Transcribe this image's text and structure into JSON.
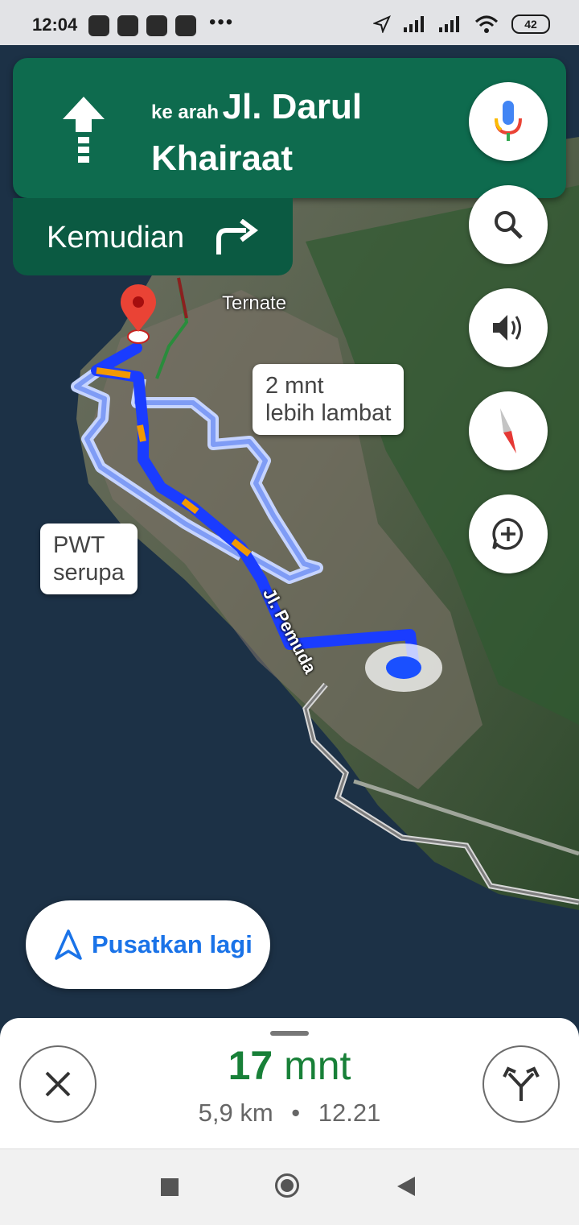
{
  "status_bar": {
    "time": "12:04",
    "more": "•••",
    "battery": "42"
  },
  "banner": {
    "prefix": "ke arah",
    "street_line1": "Jl. Darul",
    "street_line2": "Khairaat",
    "then_label": "Kemudian"
  },
  "map": {
    "place_label": "Ternate",
    "road_label": "Jl. Pemuda",
    "callout_slower": [
      "2 mnt",
      "lebih lambat"
    ],
    "callout_similar": [
      "PWT",
      "serupa"
    ]
  },
  "recenter": {
    "label": "Pusatkan lagi"
  },
  "bottom_sheet": {
    "eta_value": "17",
    "eta_unit": " mnt",
    "distance": "5,9 km",
    "separator": "•",
    "arrival_time": "12.21"
  },
  "colors": {
    "banner": "#0e6b4e",
    "then_box": "#0b5a42",
    "route": "#1a3cff",
    "eta": "#188038",
    "recenter_text": "#1a73e8"
  },
  "icons": {
    "banner": "straight-arrow-icon",
    "then": "turn-right-icon",
    "mic": "mic-icon",
    "search": "search-icon",
    "sound": "volume-icon",
    "compass": "compass-icon",
    "report": "add-report-icon",
    "recenter": "navigation-arrow-icon",
    "close": "close-icon",
    "routes": "alt-routes-icon"
  }
}
